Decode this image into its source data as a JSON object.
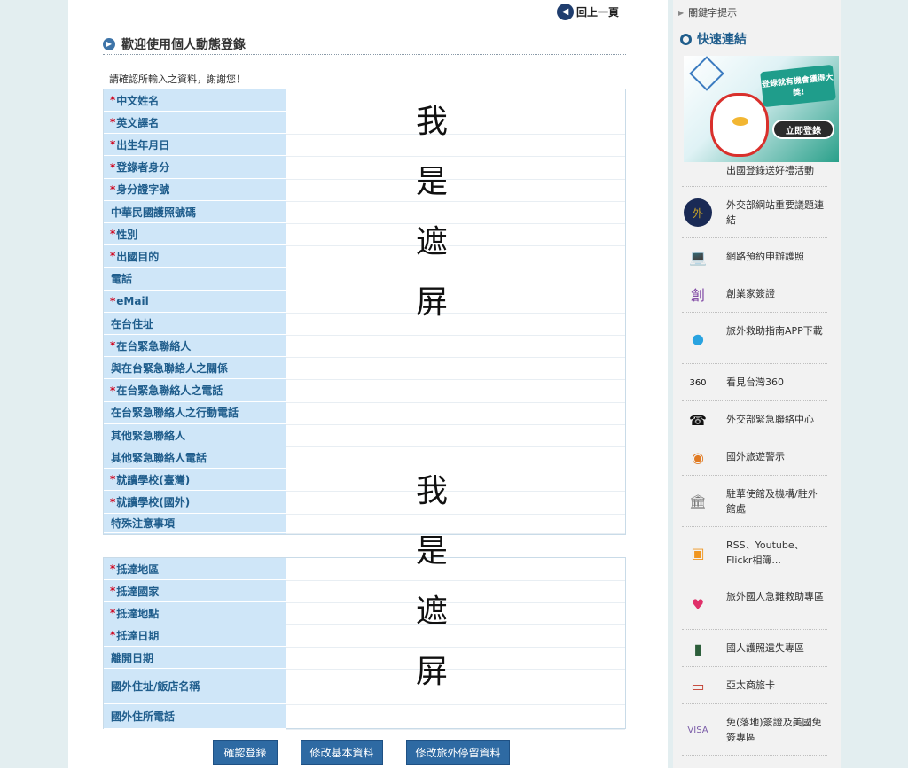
{
  "back_link": {
    "label": "回上一頁"
  },
  "page_heading": "歡迎使用個人動態登錄",
  "confirm_note": "請確認所輸入之資料，謝謝您！",
  "mask_text": [
    "我",
    "是",
    "遮",
    "屏"
  ],
  "form_section_1": [
    {
      "label": "中文姓名",
      "required": "*"
    },
    {
      "label": "英文譯名",
      "required": "*"
    },
    {
      "label": "出生年月日",
      "required": "*"
    },
    {
      "label": "登錄者身分",
      "required": "*"
    },
    {
      "label": "身分證字號",
      "required": "*"
    },
    {
      "label": "中華民國護照號碼",
      "required": ""
    },
    {
      "label": "性別",
      "required": "*"
    },
    {
      "label": "出國目的",
      "required": "*"
    },
    {
      "label": "電話",
      "required": ""
    },
    {
      "label": "eMail",
      "required": "*"
    },
    {
      "label": "在台住址",
      "required": ""
    },
    {
      "label": "在台緊急聯絡人",
      "required": "*"
    },
    {
      "label": "與在台緊急聯絡人之關係",
      "required": ""
    },
    {
      "label": "在台緊急聯絡人之電話",
      "required": "*"
    },
    {
      "label": "在台緊急聯絡人之行動電話",
      "required": ""
    },
    {
      "label": "其他緊急聯絡人",
      "required": ""
    },
    {
      "label": "其他緊急聯絡人電話",
      "required": ""
    },
    {
      "label": "就讀學校(臺灣)",
      "required": "*"
    },
    {
      "label": "就讀學校(國外)",
      "required": "*"
    },
    {
      "label": "特殊注意事項",
      "required": ""
    }
  ],
  "form_section_2": [
    {
      "label": "抵達地區",
      "required": "*"
    },
    {
      "label": "抵達國家",
      "required": "*"
    },
    {
      "label": "抵達地點",
      "required": "*"
    },
    {
      "label": "抵達日期",
      "required": "*"
    },
    {
      "label": "離開日期",
      "required": ""
    },
    {
      "label": "國外住址/飯店名稱",
      "required": ""
    },
    {
      "label": "國外住所電話",
      "required": ""
    }
  ],
  "buttons": {
    "confirm": "確認登錄",
    "modify_basic": "修改基本資料",
    "modify_travel": "修改旅外停留資料"
  },
  "sidebar": {
    "keyword_hint": "關鍵字提示",
    "quick_links_title": "快速連結",
    "promo": {
      "sign_text": "登錄就有機會獲得大獎!",
      "button_text": "立即登錄"
    },
    "links": [
      {
        "label": "出國登錄送好禮活動",
        "icon": "gift-icon"
      },
      {
        "label": "外交部網站重要議題連結",
        "icon": "mofa-seal-icon"
      },
      {
        "label": "網路預約申辦護照",
        "icon": "laptop-user-icon"
      },
      {
        "label": "創業家簽證",
        "icon": "startup-visa-icon"
      },
      {
        "label": "旅外救助指南APP下載",
        "icon": "app-bird-icon"
      },
      {
        "label": "看見台灣360",
        "icon": "360-bubble-icon"
      },
      {
        "label": "外交部緊急聯絡中心",
        "icon": "phone-icon"
      },
      {
        "label": "國外旅遊警示",
        "icon": "signal-tower-icon"
      },
      {
        "label": "駐華使館及機構/駐外館處",
        "icon": "embassy-building-icon"
      },
      {
        "label": "RSS、Youtube、Flickr相簿...",
        "icon": "rss-icon"
      },
      {
        "label": "旅外國人急難救助專區",
        "icon": "heart-hand-icon"
      },
      {
        "label": "國人護照遺失專區",
        "icon": "passport-icon"
      },
      {
        "label": "亞太商旅卡",
        "icon": "apec-card-icon"
      },
      {
        "label": "免(落地)簽證及美國免簽專區",
        "icon": "visa-icon"
      }
    ]
  },
  "colors": {
    "accent": "#1f5d8c",
    "label_bg": "#cfe6f8",
    "button_bg": "#2e6aa3",
    "required_mark": "#d0021b"
  }
}
